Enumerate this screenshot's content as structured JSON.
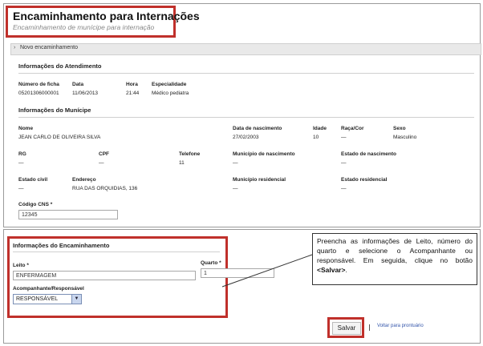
{
  "header": {
    "title": "Encaminhamento para Internações",
    "subtitle": "Encaminhamento de munícipe para internação"
  },
  "section_bar": {
    "label": "Novo encaminhamento"
  },
  "atendimento": {
    "heading": "Informações do Atendimento",
    "fields": [
      {
        "label": "Número de ficha",
        "value": "05201306000001"
      },
      {
        "label": "Data",
        "value": "11/06/2013"
      },
      {
        "label": "Hora",
        "value": "21:44"
      },
      {
        "label": "Especialidade",
        "value": "Médico pediatra"
      }
    ]
  },
  "municipe": {
    "heading": "Informações do Munícipe",
    "nome": {
      "label": "Nome",
      "value": "JEAN CARLO DE OLIVEIRA SILVA"
    },
    "data_nascimento": {
      "label": "Data de nascimento",
      "value": "27/02/2003"
    },
    "idade": {
      "label": "Idade",
      "value": "10"
    },
    "raca_cor": {
      "label": "Raça/Cor",
      "value": "—"
    },
    "sexo": {
      "label": "Sexo",
      "value": "Masculino"
    },
    "rg": {
      "label": "RG",
      "value": "—"
    },
    "cpf": {
      "label": "CPF",
      "value": "—"
    },
    "telefone": {
      "label": "Telefone",
      "value": "11"
    },
    "municipio_nascimento": {
      "label": "Município de nascimento",
      "value": "—"
    },
    "estado_nascimento": {
      "label": "Estado de nascimento",
      "value": "—"
    },
    "estado_civil": {
      "label": "Estado civil",
      "value": "—"
    },
    "endereco": {
      "label": "Endereço",
      "value": "RUA DAS ORQUIDIAS, 136"
    },
    "municipio_residencial": {
      "label": "Município residencial",
      "value": "—"
    },
    "estado_residencial": {
      "label": "Estado residencial",
      "value": "—"
    },
    "codigo_cns": {
      "label": "Código CNS *",
      "value": "12345"
    }
  },
  "encaminhamento": {
    "heading": "Informações do Encaminhamento",
    "leito": {
      "label": "Leito *",
      "value": "ENFERMAGEM"
    },
    "quarto": {
      "label": "Quarto *",
      "value": "1"
    },
    "acompanhante": {
      "label": "Acompanhante/Responsável",
      "selected": "RESPONSÁVEL"
    }
  },
  "callout": {
    "text_before": "Preencha as informações de Leito, número do quarto e selecione o Acompanhante ou responsável. Em seguida, clique no botão ",
    "bold": "<Salvar>",
    "text_after": "."
  },
  "actions": {
    "save_label": "Salvar",
    "back_link": "Voltar para prontuário"
  },
  "colors": {
    "highlight": "#c0302b",
    "link": "#3355aa"
  }
}
